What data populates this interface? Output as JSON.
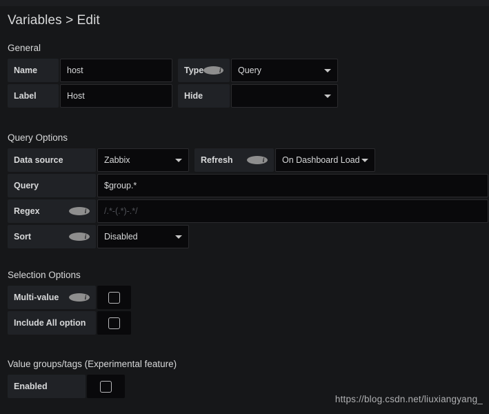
{
  "page": {
    "title": "Variables > Edit"
  },
  "general": {
    "header": "General",
    "name": {
      "label": "Name",
      "value": "host"
    },
    "type": {
      "label": "Type",
      "info_icon": "info-icon",
      "value": "Query"
    },
    "label_field": {
      "label": "Label",
      "value": "Host"
    },
    "hide": {
      "label": "Hide",
      "value": ""
    }
  },
  "query_options": {
    "header": "Query Options",
    "data_source": {
      "label": "Data source",
      "value": "Zabbix"
    },
    "refresh": {
      "label": "Refresh",
      "info_icon": "info-icon",
      "value": "On Dashboard Load"
    },
    "query": {
      "label": "Query",
      "value": "$group.*"
    },
    "regex": {
      "label": "Regex",
      "info_icon": "info-icon",
      "value": "",
      "placeholder": "/.*-(.*)-.*/"
    },
    "sort": {
      "label": "Sort",
      "info_icon": "info-icon",
      "value": "Disabled"
    }
  },
  "selection_options": {
    "header": "Selection Options",
    "multi_value": {
      "label": "Multi-value",
      "info_icon": "info-icon",
      "checked": false
    },
    "include_all": {
      "label": "Include All option",
      "checked": false
    }
  },
  "value_groups": {
    "header": "Value groups/tags (Experimental feature)",
    "enabled": {
      "label": "Enabled",
      "checked": false
    }
  },
  "watermark": {
    "text": "https://blog.csdn.net/liuxiangyang_"
  },
  "colors": {
    "background": "#161719",
    "panel": "#202226",
    "input": "#09090b",
    "text": "#d8d9da",
    "placeholder": "#52545a"
  }
}
